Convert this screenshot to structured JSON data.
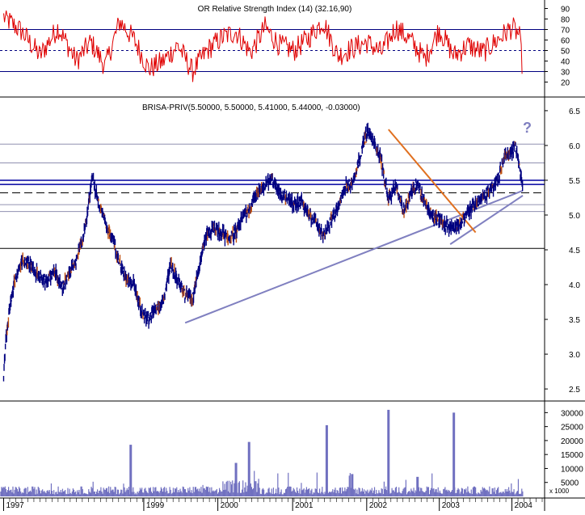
{
  "chart_data": [
    {
      "type": "line",
      "panel": "indicator",
      "title": "OR Relative Strength Index (14) (32.16,90)",
      "y_ticks": [
        20,
        30,
        40,
        50,
        60,
        70,
        80,
        90
      ],
      "ylim": [
        15,
        95
      ],
      "reference_lines": [
        {
          "value": 70,
          "style": "solid"
        },
        {
          "value": 50,
          "style": "dashed"
        },
        {
          "value": 30,
          "style": "solid"
        }
      ],
      "series": [
        {
          "color": "#e00000",
          "x": [
            1997.0,
            1997.25,
            1997.5,
            1997.75,
            1998.0,
            1998.2,
            1998.4,
            1998.6,
            1998.8,
            1999.0,
            1999.2,
            1999.4,
            1999.6,
            1999.8,
            2000.0,
            2000.2,
            2000.4,
            2000.6,
            2000.8,
            2001.0,
            2001.2,
            2001.4,
            2001.6,
            2001.8,
            2002.0,
            2002.2,
            2002.4,
            2002.6,
            2002.8,
            2003.0,
            2003.2,
            2003.4,
            2003.6,
            2003.8,
            2004.0,
            2004.1,
            2004.15
          ],
          "values": [
            82,
            68,
            45,
            72,
            40,
            58,
            35,
            78,
            60,
            32,
            40,
            55,
            30,
            50,
            62,
            68,
            48,
            72,
            55,
            50,
            62,
            78,
            45,
            52,
            58,
            48,
            72,
            60,
            42,
            70,
            45,
            55,
            48,
            60,
            72,
            65,
            32
          ]
        }
      ]
    },
    {
      "type": "line",
      "panel": "price",
      "title": "BRISA-PRIV(5.50000, 5.50000, 5.41000, 5.44000, -0.03000)",
      "y_ticks": [
        2.5,
        3.0,
        3.5,
        4.0,
        4.5,
        5.0,
        5.5,
        6.0,
        6.5
      ],
      "ylim": [
        2.35,
        6.65
      ],
      "horizontal_lines": [
        {
          "value": 6.02,
          "color": "#9090b0",
          "style": "solid"
        },
        {
          "value": 5.75,
          "color": "#9090b0",
          "style": "solid"
        },
        {
          "value": 5.5,
          "color": "#0000a0",
          "style": "solid"
        },
        {
          "value": 5.44,
          "color": "#0000a0",
          "style": "solid"
        },
        {
          "value": 5.32,
          "color": "#000000",
          "style": "dashed"
        },
        {
          "value": 5.15,
          "color": "#9090b0",
          "style": "solid"
        },
        {
          "value": 5.05,
          "color": "#9090b0",
          "style": "solid"
        },
        {
          "value": 4.52,
          "color": "#000000",
          "style": "solid"
        }
      ],
      "trendlines": [
        {
          "from": [
            1999.5,
            3.45
          ],
          "to": [
            2004.15,
            5.35
          ],
          "color": "#8080c0"
        },
        {
          "from": [
            2003.15,
            4.58
          ],
          "to": [
            2004.15,
            5.28
          ],
          "color": "#8080c0"
        },
        {
          "from": [
            2002.3,
            6.23
          ],
          "to": [
            2003.5,
            4.75
          ],
          "color": "#e07020"
        }
      ],
      "annotations": [
        "?"
      ],
      "series": [
        {
          "color": "#000080",
          "x": [
            1997.0,
            1997.02,
            1997.05,
            1997.1,
            1997.15,
            1997.25,
            1997.35,
            1997.5,
            1997.6,
            1997.7,
            1997.8,
            1997.9,
            1998.0,
            1998.08,
            1998.15,
            1998.22,
            1998.3,
            1998.4,
            1998.5,
            1998.6,
            1998.7,
            1998.8,
            1998.9,
            1999.0,
            1999.1,
            1999.2,
            1999.3,
            1999.4,
            1999.5,
            1999.6,
            1999.7,
            1999.8,
            1999.9,
            2000.0,
            2000.1,
            2000.2,
            2000.3,
            2000.4,
            2000.5,
            2000.6,
            2000.7,
            2000.8,
            2000.9,
            2001.0,
            2001.1,
            2001.2,
            2001.3,
            2001.4,
            2001.5,
            2001.6,
            2001.7,
            2001.8,
            2001.9,
            2002.0,
            2002.1,
            2002.2,
            2002.25,
            2002.3,
            2002.35,
            2002.4,
            2002.5,
            2002.6,
            2002.7,
            2002.8,
            2002.9,
            2003.0,
            2003.1,
            2003.2,
            2003.3,
            2003.4,
            2003.5,
            2003.6,
            2003.7,
            2003.8,
            2003.9,
            2004.0,
            2004.05,
            2004.1,
            2004.15
          ],
          "values": [
            2.62,
            3.05,
            3.4,
            3.75,
            4.05,
            4.35,
            4.3,
            4.1,
            4.05,
            4.2,
            3.95,
            4.15,
            4.35,
            4.6,
            5.0,
            5.55,
            5.2,
            4.9,
            4.65,
            4.3,
            4.05,
            4.0,
            3.6,
            3.5,
            3.65,
            3.75,
            4.3,
            4.05,
            3.85,
            3.8,
            4.3,
            4.75,
            4.8,
            4.75,
            4.65,
            4.75,
            5.0,
            5.1,
            5.35,
            5.4,
            5.55,
            5.3,
            5.25,
            5.15,
            5.2,
            5.0,
            4.9,
            4.7,
            4.9,
            5.1,
            5.4,
            5.45,
            5.8,
            6.22,
            6.05,
            5.8,
            5.5,
            5.25,
            5.3,
            5.4,
            5.05,
            5.3,
            5.45,
            5.15,
            5.0,
            4.95,
            4.85,
            4.8,
            4.9,
            5.05,
            5.15,
            5.25,
            5.35,
            5.5,
            5.85,
            5.9,
            6.0,
            5.7,
            5.44
          ]
        }
      ]
    },
    {
      "type": "bar",
      "panel": "volume",
      "y_ticks": [
        5000,
        10000,
        15000,
        20000,
        25000,
        30000
      ],
      "ylim": [
        0,
        33000
      ],
      "unit_label": "x 1000",
      "spikes": [
        {
          "x": 1998.75,
          "value": 18500
        },
        {
          "x": 2000.38,
          "value": 19500
        },
        {
          "x": 2001.45,
          "value": 25500
        },
        {
          "x": 2002.3,
          "value": 31000
        },
        {
          "x": 2003.2,
          "value": 30000
        },
        {
          "x": 2000.2,
          "value": 12000
        },
        {
          "x": 2001.8,
          "value": 8000
        },
        {
          "x": 2002.7,
          "value": 7000
        }
      ],
      "baseline_level": 1800,
      "series": [
        {
          "color": "#7070c0"
        }
      ]
    }
  ],
  "x_axis": {
    "range": [
      1996.95,
      2004.45
    ],
    "tick_labels": [
      "1997",
      "1999",
      "2000",
      "2001",
      "2002",
      "2003",
      "2004"
    ],
    "tick_values": [
      1997.0,
      1998.93,
      1999.95,
      2000.98,
      2002.0,
      2003.0,
      2004.0
    ]
  }
}
